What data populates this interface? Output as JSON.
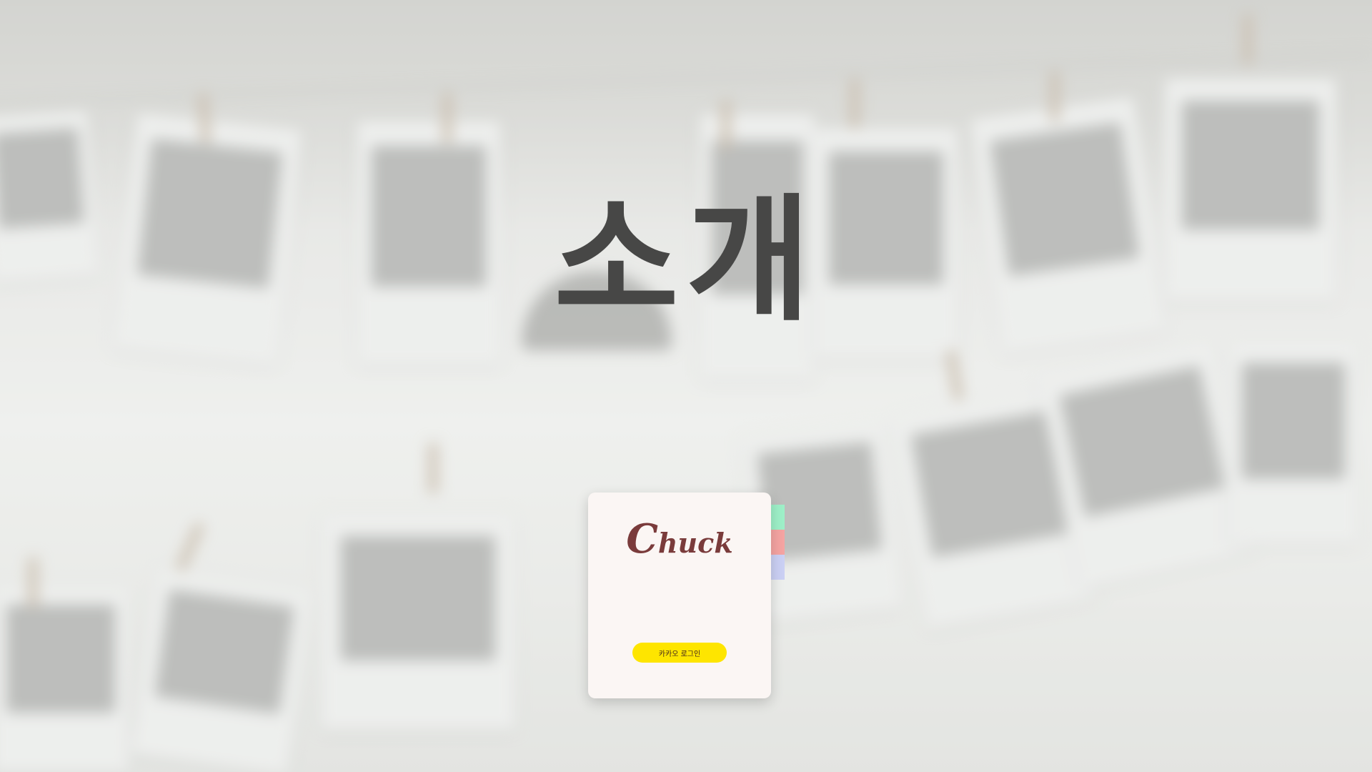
{
  "hero": {
    "title": "소개"
  },
  "card": {
    "logo": {
      "first": "C",
      "rest": "huck"
    },
    "login_button": "카카오 로그인",
    "tabs": [
      {
        "color": "#9ef0c8"
      },
      {
        "color": "#f5a4a2"
      },
      {
        "color": "#cbd0f4"
      }
    ]
  },
  "colors": {
    "accent_logo": "#7a3b3b",
    "kakao_yellow": "#fee500",
    "hero_text": "#474746"
  }
}
